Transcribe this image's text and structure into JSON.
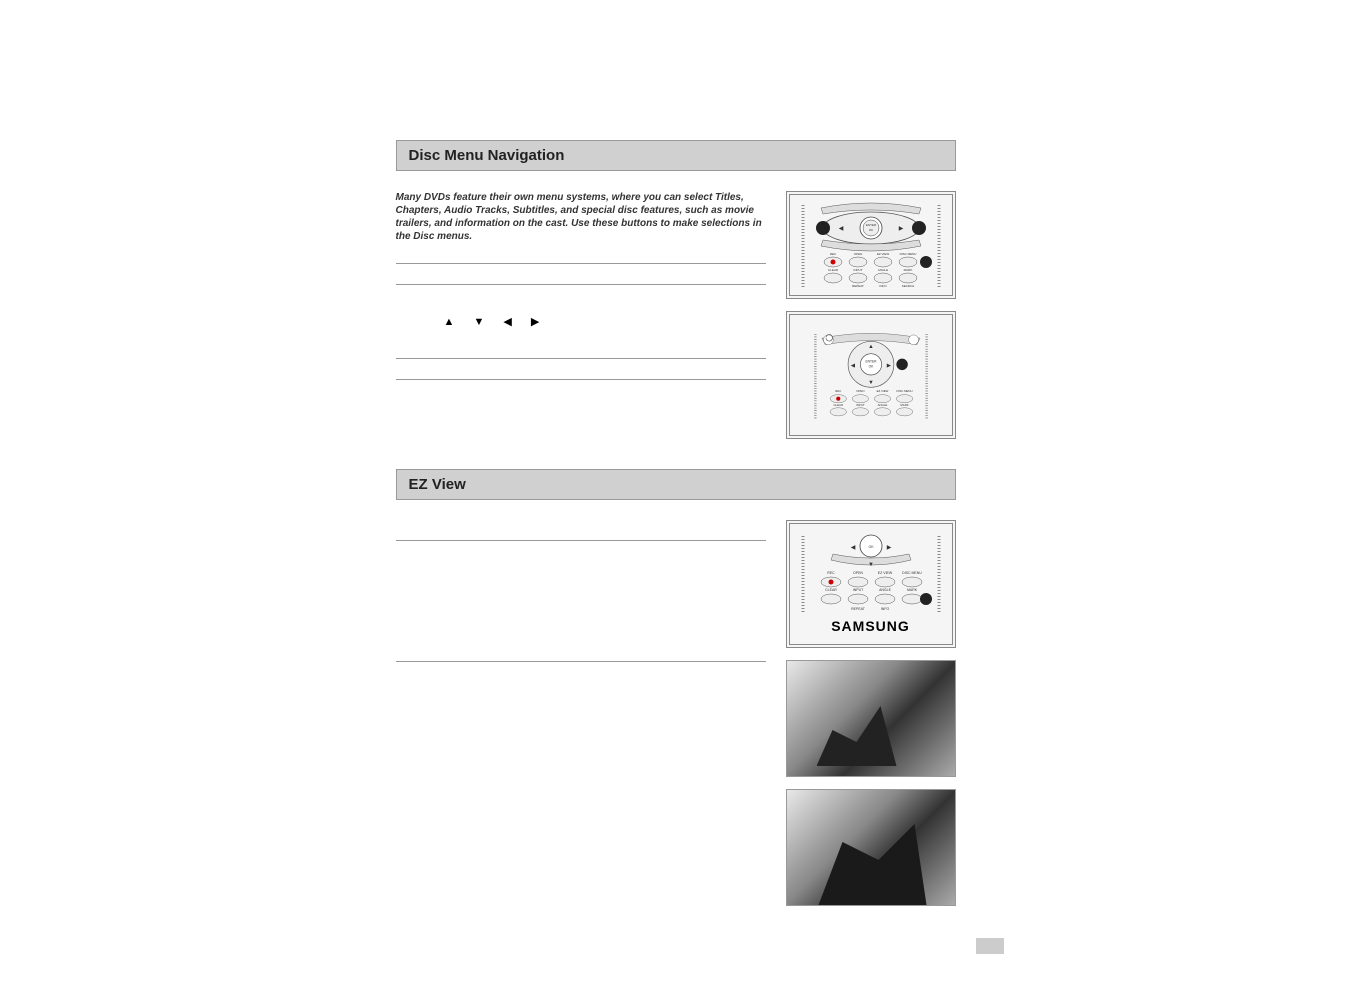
{
  "sections": {
    "disc_menu": {
      "title": "Disc Menu Navigation",
      "intro": "Many DVDs feature their own menu systems, where you can select Titles, Chapters, Audio Tracks, Subtitles, and special disc features, such as movie trailers, and information on the cast. Use these buttons to make selections in the Disc menus.",
      "arrow_glyphs": "▲ ▼   ◀  ▶"
    },
    "ez_view": {
      "title": "EZ View",
      "brand": "SAMSUNG"
    }
  },
  "remote_labels": {
    "enter": "ENTER",
    "ok": "OK",
    "rec": "REC",
    "open": "OPEN",
    "ez_view": "EZ VIEW",
    "disc_menu": "DISC MENU",
    "clear": "CLEAR",
    "input": "INPUT",
    "angle": "ANGLE",
    "mark": "MARK",
    "repeat": "REPEAT",
    "info": "INFO",
    "search": "SEARCH"
  }
}
